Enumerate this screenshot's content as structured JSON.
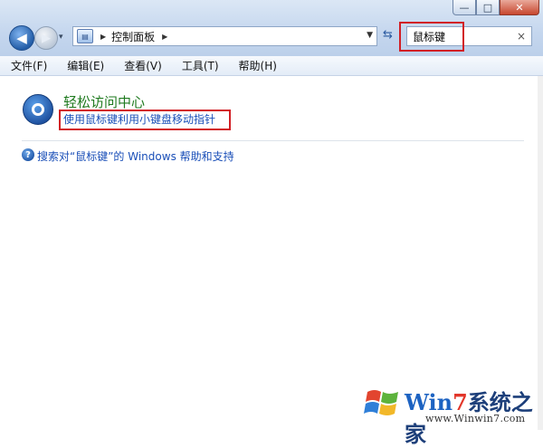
{
  "window": {
    "minimize": "—",
    "maximize": "□",
    "close": "✕"
  },
  "nav": {
    "back_glyph": "◀",
    "forward_glyph": "▶",
    "history_glyph": "▾"
  },
  "address": {
    "separator": "▶",
    "crumb": "控制面板",
    "trailing_separator": "▶",
    "dropdown": "▼"
  },
  "refresh": {
    "glyph": "⇆"
  },
  "search": {
    "value": "鼠标键",
    "clear": "×"
  },
  "menu": {
    "items": [
      "文件(F)",
      "编辑(E)",
      "查看(V)",
      "工具(T)",
      "帮助(H)"
    ]
  },
  "result": {
    "title": "轻松访问中心",
    "link": "使用鼠标键利用小键盘移动指针"
  },
  "help": {
    "glyph": "?",
    "text": "搜索对“鼠标键”的 Windows 帮助和支持"
  },
  "watermark": {
    "brand_w": "Win",
    "brand_7": "7",
    "brand_cn": "系统之家",
    "url": "www.Winwin7.com"
  },
  "colors": {
    "highlight_box": "#d21f25",
    "link": "#1a4fb8",
    "category_title": "#1f7a1f"
  }
}
